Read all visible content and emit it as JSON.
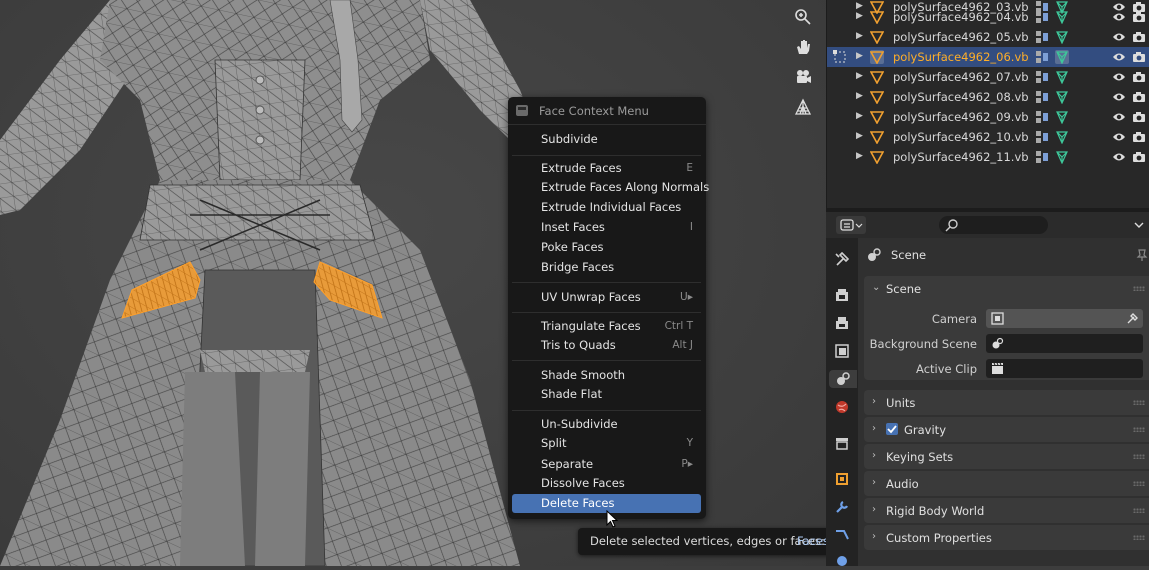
{
  "context_menu": {
    "title": "Face Context Menu",
    "items": [
      {
        "label": "Subdivide",
        "shortcut": ""
      },
      {
        "label": "Extrude Faces",
        "shortcut": "E"
      },
      {
        "label": "Extrude Faces Along Normals",
        "shortcut": ""
      },
      {
        "label": "Extrude Individual Faces",
        "shortcut": ""
      },
      {
        "label": "Inset Faces",
        "shortcut": "I"
      },
      {
        "label": "Poke Faces",
        "shortcut": ""
      },
      {
        "label": "Bridge Faces",
        "shortcut": ""
      },
      {
        "label": "UV Unwrap Faces",
        "shortcut": "U▸"
      },
      {
        "label": "Triangulate Faces",
        "shortcut": "Ctrl T"
      },
      {
        "label": "Tris to Quads",
        "shortcut": "Alt J"
      },
      {
        "label": "Shade Smooth",
        "shortcut": ""
      },
      {
        "label": "Shade Flat",
        "shortcut": ""
      },
      {
        "label": "Un-Subdivide",
        "shortcut": ""
      },
      {
        "label": "Split",
        "shortcut": "Y"
      },
      {
        "label": "Separate",
        "shortcut": "P▸"
      },
      {
        "label": "Dissolve Faces",
        "shortcut": ""
      },
      {
        "label": "Delete Faces",
        "shortcut": ""
      }
    ]
  },
  "tooltip": {
    "text": "Delete selected vertices, edges or faces:",
    "value": "Faces"
  },
  "outliner": {
    "items": [
      {
        "name": "polySurface4962_03.vb",
        "selected": false
      },
      {
        "name": "polySurface4962_04.vb",
        "selected": false
      },
      {
        "name": "polySurface4962_05.vb",
        "selected": false
      },
      {
        "name": "polySurface4962_06.vb",
        "selected": true
      },
      {
        "name": "polySurface4962_07.vb",
        "selected": false
      },
      {
        "name": "polySurface4962_08.vb",
        "selected": false
      },
      {
        "name": "polySurface4962_09.vb",
        "selected": false
      },
      {
        "name": "polySurface4962_10.vb",
        "selected": false
      },
      {
        "name": "polySurface4962_11.vb",
        "selected": false
      }
    ]
  },
  "properties": {
    "context": "Scene",
    "panels": {
      "scene": "Scene",
      "camera_label": "Camera",
      "background_scene_label": "Background Scene",
      "active_clip_label": "Active Clip",
      "units": "Units",
      "gravity": "Gravity",
      "keying_sets": "Keying Sets",
      "audio": "Audio",
      "rigid_body_world": "Rigid Body World",
      "custom_properties": "Custom Properties"
    },
    "gravity_checked": true
  },
  "colors": {
    "selection_blue": "#4772b3",
    "selected_object_text": "#ffaf29",
    "face_selection": "#f0a030",
    "data_green": "#3ec79a"
  }
}
